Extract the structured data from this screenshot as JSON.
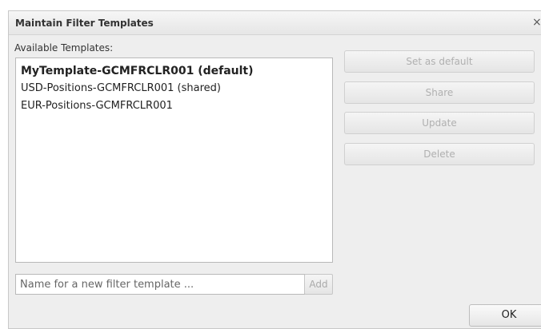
{
  "dialog": {
    "title": "Maintain Filter Templates",
    "close_symbol": "×",
    "close_icon": "close-icon"
  },
  "templates": {
    "label": "Available Templates:",
    "items": [
      {
        "label": "MyTemplate-GCMFRCLR001 (default)",
        "is_default": true
      },
      {
        "label": "USD-Positions-GCMFRCLR001 (shared)",
        "is_default": false
      },
      {
        "label": "EUR-Positions-GCMFRCLR001",
        "is_default": false
      }
    ]
  },
  "actions": {
    "set_default_label": "Set as default",
    "share_label": "Share",
    "update_label": "Update",
    "delete_label": "Delete"
  },
  "new_template": {
    "placeholder": "Name for a new filter template ...",
    "value": "",
    "add_label": "Add"
  },
  "footer": {
    "ok_label": "OK"
  }
}
